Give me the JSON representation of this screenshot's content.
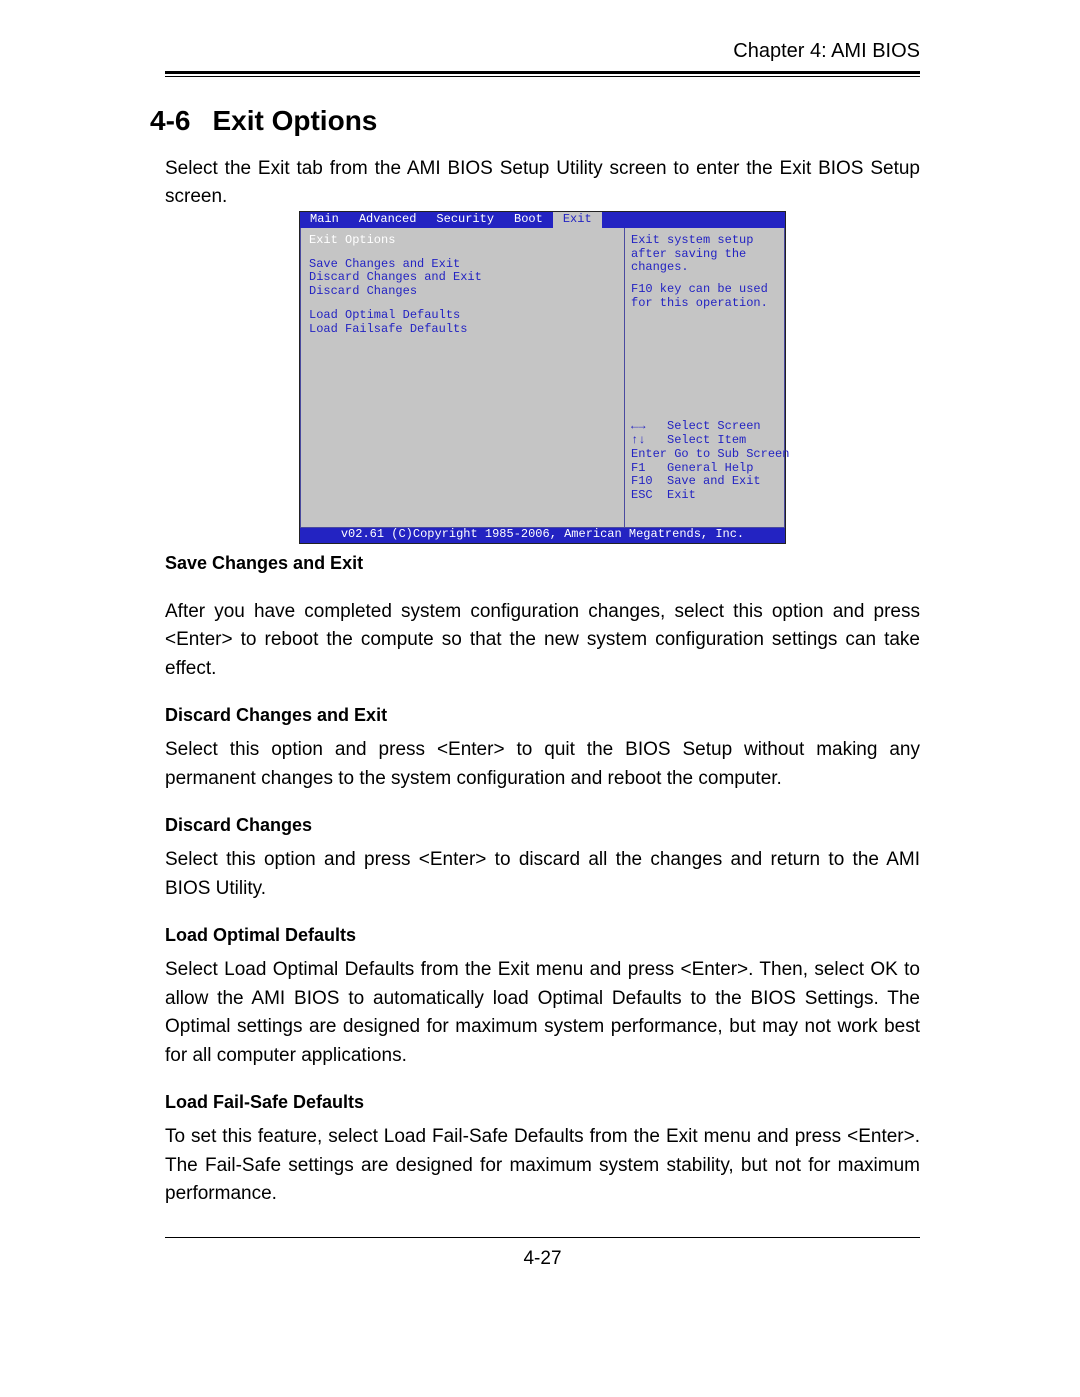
{
  "header": {
    "chapter": "Chapter 4: AMI BIOS"
  },
  "section": {
    "number": "4-6",
    "title": "Exit Options",
    "intro": "Select the Exit tab from the AMI BIOS Setup Utility screen to enter the Exit BIOS Setup screen."
  },
  "bios": {
    "tabs": [
      "Main",
      "Advanced",
      "Security",
      "Boot",
      "Exit"
    ],
    "active_tab": "Exit",
    "panel_title": "Exit Options",
    "items": [
      "Save Changes and Exit",
      "Discard Changes and Exit",
      "Discard Changes",
      "",
      "Load Optimal Defaults",
      "Load Failsafe Defaults"
    ],
    "help1": "Exit system setup after saving the changes.",
    "help2": "F10 key can be used for this operation.",
    "nav": [
      "←→   Select Screen",
      "↑↓   Select Item",
      "Enter Go to Sub Screen",
      "F1   General Help",
      "F10  Save and Exit",
      "ESC  Exit"
    ],
    "footer": "v02.61 (C)Copyright 1985-2006, American Megatrends, Inc."
  },
  "subsections": [
    {
      "title": "Save Changes and Exit",
      "body": "After you have completed system configuration changes, select this option and press <Enter> to reboot the compute so that the new system configuration settings can take effect."
    },
    {
      "title": "Discard Changes and Exit",
      "body": "Select this option and press <Enter> to quit the BIOS Setup without making any permanent changes to the system configuration and reboot the computer."
    },
    {
      "title": "Discard Changes",
      "body": "Select this option and press <Enter> to discard all the changes and return to the AMI BIOS Utility."
    },
    {
      "title": "Load Optimal Defaults",
      "body": "Select Load Optimal Defaults from the Exit menu and press <Enter>. Then, select OK to allow the AMI BIOS to automatically load Optimal Defaults to the BIOS Settings. The Optimal settings are designed for maximum system performance, but may not work best for all computer applications."
    },
    {
      "title": "Load Fail-Safe Defaults",
      "body": "To set this feature, select Load Fail-Safe Defaults from the Exit menu and press <Enter>. The Fail-Safe settings are designed for maximum system stability, but not for maximum performance."
    }
  ],
  "page_number": "4-27"
}
